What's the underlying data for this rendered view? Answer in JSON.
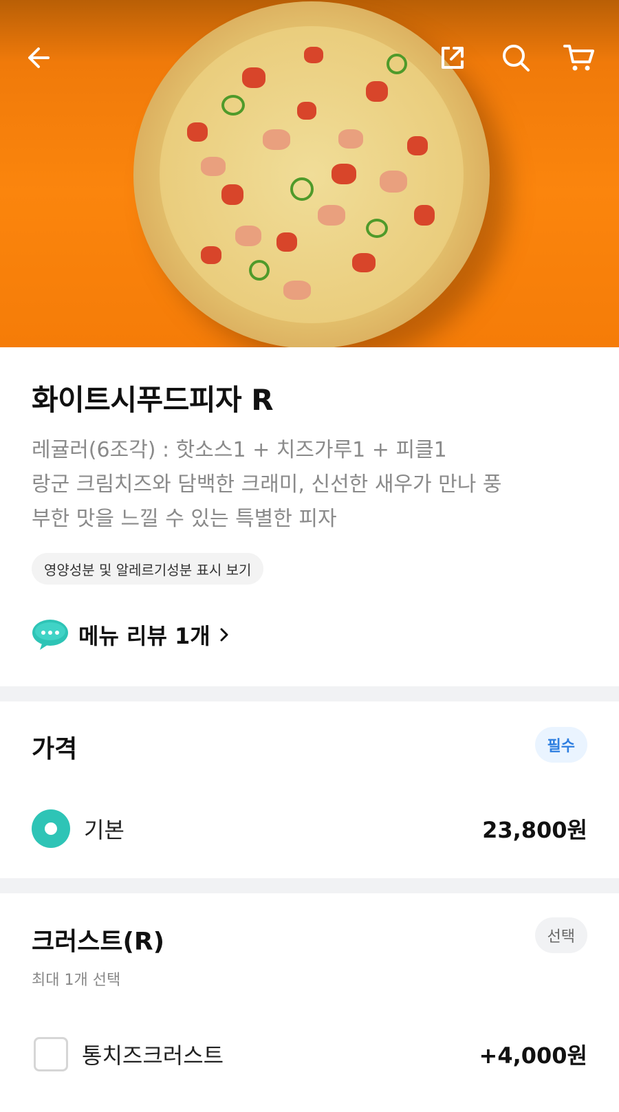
{
  "header": {
    "back_icon": "arrow-left-icon",
    "share_icon": "share-icon",
    "search_icon": "search-icon",
    "cart_icon": "cart-icon"
  },
  "product": {
    "title": "화이트시푸드피자 R",
    "description_line1": "레귤러(6조각) : 핫소스1 + 치즈가루1 + 피클1",
    "description_line2": "랑군 크림치즈와 담백한 크래미, 신선한 새우가 만나 풍",
    "description_line3": "부한 맛을 느낄 수 있는 특별한 피자",
    "nutrition_link": "영양성분 및 알레르기성분 표시 보기",
    "review_label": "메뉴 리뷰 1개"
  },
  "price_section": {
    "title": "가격",
    "badge": "필수",
    "option_label": "기본",
    "option_price": "23,800원"
  },
  "crust_section": {
    "title": "크러스트(R)",
    "badge": "선택",
    "hint": "최대 1개 선택",
    "option_label": "통치즈크러스트",
    "option_price": "+4,000원"
  },
  "colors": {
    "accent": "#2ec4b6",
    "required_badge": "#2f7fe0",
    "hero_bg": "#fb850d"
  }
}
